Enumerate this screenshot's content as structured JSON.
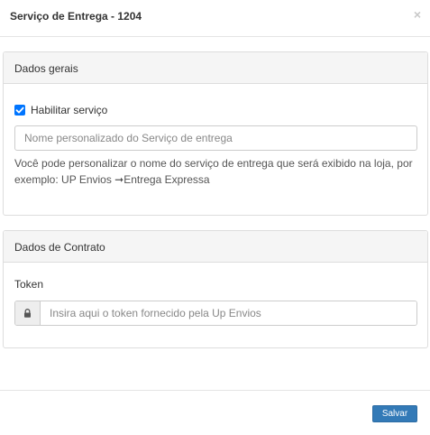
{
  "modal": {
    "title": "Serviço de Entrega - 1204",
    "close_glyph": "×"
  },
  "general": {
    "heading": "Dados gerais",
    "enable_label": "Habilitar serviço",
    "enable_checked": true,
    "name_placeholder": "Nome personalizado do Serviço de entrega",
    "help_text": "Você pode personalizar o nome do serviço de entrega que será exibido na loja, por exemplo: UP Envios ➞Entrega Expressa"
  },
  "contract": {
    "heading": "Dados de Contrato",
    "token_label": "Token",
    "token_placeholder": "Insira aqui o token fornecido pela Up Envios",
    "token_icon": "lock-icon"
  },
  "footer": {
    "save_label": "Salvar"
  },
  "colors": {
    "primary": "#337ab7",
    "checkbox": "#0075ff",
    "panel_heading_bg": "#f5f5f5",
    "border": "#dddddd"
  }
}
